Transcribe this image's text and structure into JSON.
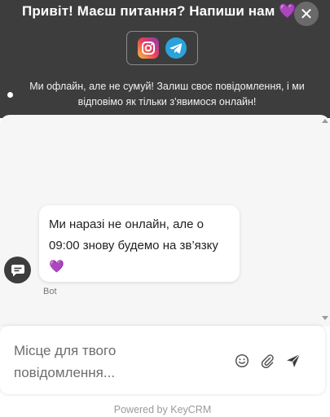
{
  "header": {
    "title": "Привіт! Маєш питання? Напиши нам 💜",
    "close_label": "✕",
    "offline_message": "Ми офлайн, але не сумуй! Залиш своє повідомлення, і ми відповімо як тільки з'явимося онлайн!",
    "social": [
      {
        "name": "instagram-icon"
      },
      {
        "name": "telegram-icon"
      }
    ]
  },
  "chat": {
    "messages": [
      {
        "sender": "Bot",
        "text": "Ми наразі не онлайн, але о 09:00 знову будемо на зв’язку 💜"
      }
    ]
  },
  "composer": {
    "placeholder": "Місце для твого повідомлення..."
  },
  "footer": {
    "powered_by": "Powered by KeyCRM"
  },
  "colors": {
    "header_bg": "#3d3d3d",
    "telegram": "#2aa3dd"
  }
}
